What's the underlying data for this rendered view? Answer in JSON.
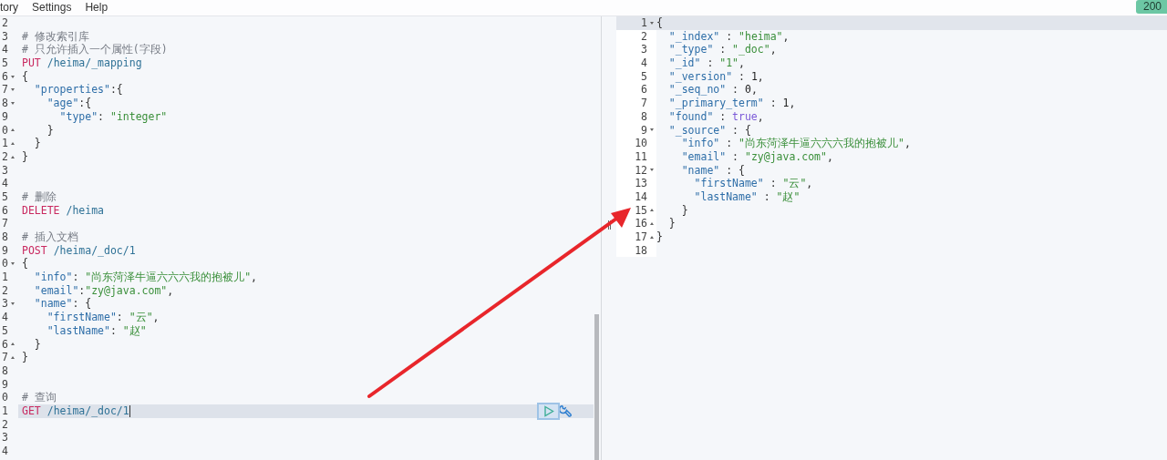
{
  "menu": [
    "tory",
    "Settings",
    "Help"
  ],
  "status_badge": "200",
  "request_editor": {
    "lines": [
      {
        "num": "2",
        "kind": "plain",
        "active": false
      },
      {
        "num": "3",
        "kind": "plain",
        "active": false,
        "tokens": [
          {
            "kind": "comment",
            "text": "# 修改索引库"
          }
        ]
      },
      {
        "num": "4",
        "kind": "plain",
        "active": false,
        "tokens": [
          {
            "kind": "comment",
            "text": "# 只允许插入一个属性(字段)"
          }
        ]
      },
      {
        "num": "5",
        "kind": "plain",
        "active": false,
        "tokens": [
          {
            "kind": "method",
            "text": "PUT"
          },
          {
            "kind": "path",
            "text": " /heima/_mapping"
          }
        ]
      },
      {
        "num": "6",
        "kind": "fold_start",
        "active": false,
        "tokens": [
          {
            "kind": "punct",
            "text": "{"
          }
        ]
      },
      {
        "num": "7",
        "kind": "fold_start",
        "active": false,
        "tokens": [
          {
            "kind": "key",
            "text": "  \"properties\""
          },
          {
            "kind": "punct",
            "text": ":{"
          }
        ]
      },
      {
        "num": "8",
        "kind": "fold_start",
        "active": false,
        "tokens": [
          {
            "kind": "key",
            "text": "    \"age\""
          },
          {
            "kind": "punct",
            "text": ":{"
          }
        ]
      },
      {
        "num": "9",
        "kind": "plain",
        "active": false,
        "tokens": [
          {
            "kind": "key",
            "text": "      \"type\""
          },
          {
            "kind": "punct",
            "text": ": "
          },
          {
            "kind": "string",
            "text": "\"integer\""
          }
        ]
      },
      {
        "num": "0",
        "kind": "fold_end",
        "active": false,
        "tokens": [
          {
            "kind": "punct",
            "text": "    }"
          }
        ]
      },
      {
        "num": "1",
        "kind": "fold_end",
        "active": false,
        "tokens": [
          {
            "kind": "punct",
            "text": "  }"
          }
        ]
      },
      {
        "num": "2",
        "kind": "fold_end",
        "active": false,
        "tokens": [
          {
            "kind": "punct",
            "text": "}"
          }
        ]
      },
      {
        "num": "3",
        "kind": "plain",
        "active": false
      },
      {
        "num": "4",
        "kind": "plain",
        "active": false
      },
      {
        "num": "5",
        "kind": "plain",
        "active": false,
        "tokens": [
          {
            "kind": "comment",
            "text": "# 删除"
          }
        ]
      },
      {
        "num": "6",
        "kind": "plain",
        "active": false,
        "tokens": [
          {
            "kind": "method",
            "text": "DELETE"
          },
          {
            "kind": "path",
            "text": " /heima"
          }
        ]
      },
      {
        "num": "7",
        "kind": "plain",
        "active": false
      },
      {
        "num": "8",
        "kind": "plain",
        "active": false,
        "tokens": [
          {
            "kind": "comment",
            "text": "# 插入文档"
          }
        ]
      },
      {
        "num": "9",
        "kind": "plain",
        "active": false,
        "tokens": [
          {
            "kind": "method",
            "text": "POST"
          },
          {
            "kind": "path",
            "text": " /heima/_doc/1"
          }
        ]
      },
      {
        "num": "0",
        "kind": "fold_start",
        "active": false,
        "tokens": [
          {
            "kind": "punct",
            "text": "{"
          }
        ]
      },
      {
        "num": "1",
        "kind": "plain",
        "active": false,
        "tokens": [
          {
            "kind": "key",
            "text": "  \"info\""
          },
          {
            "kind": "punct",
            "text": ": "
          },
          {
            "kind": "string",
            "text": "\"尚东菏泽牛逼六六六我的抱被儿\""
          },
          {
            "kind": "punct",
            "text": ","
          }
        ]
      },
      {
        "num": "2",
        "kind": "plain",
        "active": false,
        "tokens": [
          {
            "kind": "key",
            "text": "  \"email\""
          },
          {
            "kind": "punct",
            "text": ":"
          },
          {
            "kind": "string",
            "text": "\"zy@java.com\""
          },
          {
            "kind": "punct",
            "text": ","
          }
        ]
      },
      {
        "num": "3",
        "kind": "fold_start",
        "active": false,
        "tokens": [
          {
            "kind": "key",
            "text": "  \"name\""
          },
          {
            "kind": "punct",
            "text": ": {"
          }
        ]
      },
      {
        "num": "4",
        "kind": "plain",
        "active": false,
        "tokens": [
          {
            "kind": "key",
            "text": "    \"firstName\""
          },
          {
            "kind": "punct",
            "text": ": "
          },
          {
            "kind": "string",
            "text": "\"云\""
          },
          {
            "kind": "punct",
            "text": ","
          }
        ]
      },
      {
        "num": "5",
        "kind": "plain",
        "active": false,
        "tokens": [
          {
            "kind": "key",
            "text": "    \"lastName\""
          },
          {
            "kind": "punct",
            "text": ": "
          },
          {
            "kind": "string",
            "text": "\"赵\""
          }
        ]
      },
      {
        "num": "6",
        "kind": "fold_end",
        "active": false,
        "tokens": [
          {
            "kind": "punct",
            "text": "  }"
          }
        ]
      },
      {
        "num": "7",
        "kind": "fold_end",
        "active": false,
        "tokens": [
          {
            "kind": "punct",
            "text": "}"
          }
        ]
      },
      {
        "num": "8",
        "kind": "plain",
        "active": false
      },
      {
        "num": "9",
        "kind": "plain",
        "active": false
      },
      {
        "num": "0",
        "kind": "plain",
        "active": false,
        "tokens": [
          {
            "kind": "comment",
            "text": "# 查询"
          }
        ]
      },
      {
        "num": "1",
        "kind": "plain",
        "active": true,
        "tokens": [
          {
            "kind": "method",
            "text": "GET"
          },
          {
            "kind": "path",
            "text": " /heima/_doc/1"
          }
        ]
      },
      {
        "num": "2",
        "kind": "plain",
        "active": false
      },
      {
        "num": "3",
        "kind": "plain",
        "active": false
      },
      {
        "num": "4",
        "kind": "plain",
        "active": false
      }
    ]
  },
  "response_editor": {
    "lines": [
      {
        "num": "1",
        "kind": "fold_start",
        "active": true,
        "tokens": [
          {
            "kind": "punct",
            "text": "{"
          }
        ]
      },
      {
        "num": "2",
        "kind": "plain",
        "active": false,
        "tokens": [
          {
            "kind": "key",
            "text": "  \"_index\""
          },
          {
            "kind": "punct",
            "text": " : "
          },
          {
            "kind": "string",
            "text": "\"heima\""
          },
          {
            "kind": "punct",
            "text": ","
          }
        ]
      },
      {
        "num": "3",
        "kind": "plain",
        "active": false,
        "tokens": [
          {
            "kind": "key",
            "text": "  \"_type\""
          },
          {
            "kind": "punct",
            "text": " : "
          },
          {
            "kind": "string",
            "text": "\"_doc\""
          },
          {
            "kind": "punct",
            "text": ","
          }
        ]
      },
      {
        "num": "4",
        "kind": "plain",
        "active": false,
        "tokens": [
          {
            "kind": "key",
            "text": "  \"_id\""
          },
          {
            "kind": "punct",
            "text": " : "
          },
          {
            "kind": "string",
            "text": "\"1\""
          },
          {
            "kind": "punct",
            "text": ","
          }
        ]
      },
      {
        "num": "5",
        "kind": "plain",
        "active": false,
        "tokens": [
          {
            "kind": "key",
            "text": "  \"_version\""
          },
          {
            "kind": "punct",
            "text": " : "
          },
          {
            "kind": "number",
            "text": "1"
          },
          {
            "kind": "punct",
            "text": ","
          }
        ]
      },
      {
        "num": "6",
        "kind": "plain",
        "active": false,
        "tokens": [
          {
            "kind": "key",
            "text": "  \"_seq_no\""
          },
          {
            "kind": "punct",
            "text": " : "
          },
          {
            "kind": "number",
            "text": "0"
          },
          {
            "kind": "punct",
            "text": ","
          }
        ]
      },
      {
        "num": "7",
        "kind": "plain",
        "active": false,
        "tokens": [
          {
            "kind": "key",
            "text": "  \"_primary_term\""
          },
          {
            "kind": "punct",
            "text": " : "
          },
          {
            "kind": "number",
            "text": "1"
          },
          {
            "kind": "punct",
            "text": ","
          }
        ]
      },
      {
        "num": "8",
        "kind": "plain",
        "active": false,
        "tokens": [
          {
            "kind": "key",
            "text": "  \"found\""
          },
          {
            "kind": "punct",
            "text": " : "
          },
          {
            "kind": "bool",
            "text": "true"
          },
          {
            "kind": "punct",
            "text": ","
          }
        ]
      },
      {
        "num": "9",
        "kind": "fold_start",
        "active": false,
        "tokens": [
          {
            "kind": "key",
            "text": "  \"_source\""
          },
          {
            "kind": "punct",
            "text": " : {"
          }
        ]
      },
      {
        "num": "10",
        "kind": "plain",
        "active": false,
        "tokens": [
          {
            "kind": "key",
            "text": "    \"info\""
          },
          {
            "kind": "punct",
            "text": " : "
          },
          {
            "kind": "string",
            "text": "\"尚东菏泽牛逼六六六我的抱被儿\""
          },
          {
            "kind": "punct",
            "text": ","
          }
        ]
      },
      {
        "num": "11",
        "kind": "plain",
        "active": false,
        "tokens": [
          {
            "kind": "key",
            "text": "    \"email\""
          },
          {
            "kind": "punct",
            "text": " : "
          },
          {
            "kind": "string",
            "text": "\"zy@java.com\""
          },
          {
            "kind": "punct",
            "text": ","
          }
        ]
      },
      {
        "num": "12",
        "kind": "fold_start",
        "active": false,
        "tokens": [
          {
            "kind": "key",
            "text": "    \"name\""
          },
          {
            "kind": "punct",
            "text": " : {"
          }
        ]
      },
      {
        "num": "13",
        "kind": "plain",
        "active": false,
        "tokens": [
          {
            "kind": "key",
            "text": "      \"firstName\""
          },
          {
            "kind": "punct",
            "text": " : "
          },
          {
            "kind": "string",
            "text": "\"云\""
          },
          {
            "kind": "punct",
            "text": ","
          }
        ]
      },
      {
        "num": "14",
        "kind": "plain",
        "active": false,
        "tokens": [
          {
            "kind": "key",
            "text": "      \"lastName\""
          },
          {
            "kind": "punct",
            "text": " : "
          },
          {
            "kind": "string",
            "text": "\"赵\""
          }
        ]
      },
      {
        "num": "15",
        "kind": "fold_end",
        "active": false,
        "tokens": [
          {
            "kind": "punct",
            "text": "    }"
          }
        ]
      },
      {
        "num": "16",
        "kind": "fold_end",
        "active": false,
        "tokens": [
          {
            "kind": "punct",
            "text": "  }"
          }
        ]
      },
      {
        "num": "17",
        "kind": "fold_end",
        "active": false,
        "tokens": [
          {
            "kind": "punct",
            "text": "}"
          }
        ]
      },
      {
        "num": "18",
        "kind": "plain",
        "active": false
      }
    ]
  }
}
